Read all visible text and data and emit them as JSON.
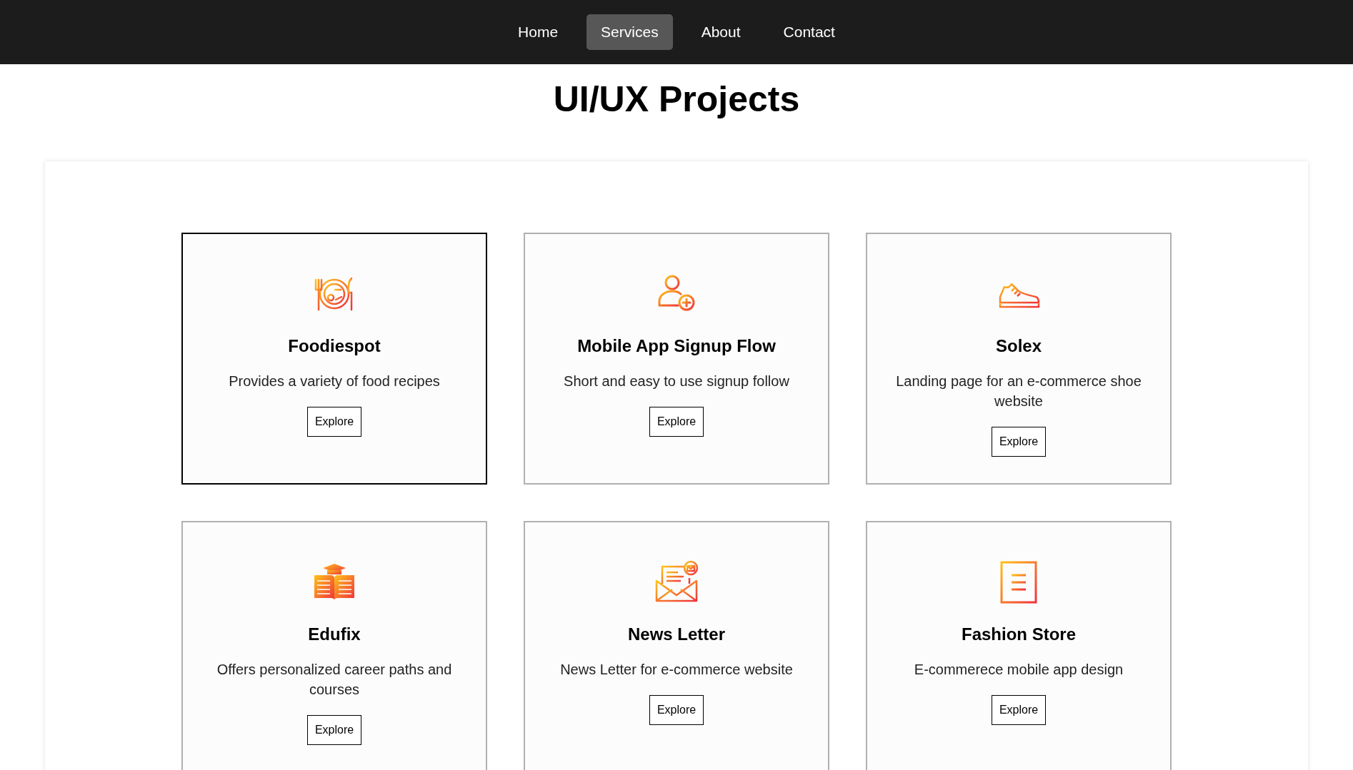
{
  "nav": [
    {
      "label": "Home",
      "selected": false
    },
    {
      "label": "Services",
      "selected": true
    },
    {
      "label": "About",
      "selected": false
    },
    {
      "label": "Contact",
      "selected": false
    }
  ],
  "heading": "UI/UX Projects",
  "projects": [
    {
      "title": "Foodiespot",
      "description": "Provides a variety of food recipes",
      "button": "Explore",
      "highlighted": true
    },
    {
      "title": "Mobile App Signup Flow",
      "description": "Short and easy to use signup follow",
      "button": "Explore",
      "highlighted": false
    },
    {
      "title": "Solex",
      "description": "Landing page for an e-commerce shoe website",
      "button": "Explore",
      "highlighted": false
    },
    {
      "title": "Edufix",
      "description": "Offers personalized career paths and courses",
      "button": "Explore",
      "highlighted": false
    },
    {
      "title": "News Letter",
      "description": "News Letter for e-commerce website",
      "button": "Explore",
      "highlighted": false
    },
    {
      "title": "Fashion Store",
      "description": "E-commerece mobile app design",
      "button": "Explore",
      "highlighted": false
    }
  ]
}
